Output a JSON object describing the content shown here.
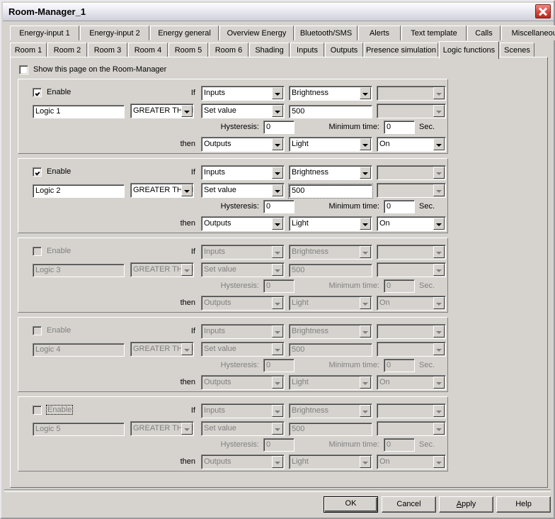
{
  "window": {
    "title": "Room-Manager_1",
    "close_label": "close-icon"
  },
  "tabs": {
    "row1": [
      {
        "label": "Energy-input 1",
        "selected": false
      },
      {
        "label": "Energy-input 2",
        "selected": false
      },
      {
        "label": "Energy general",
        "selected": false
      },
      {
        "label": "Overview Energy",
        "selected": false
      },
      {
        "label": "Bluetooth/SMS",
        "selected": false
      },
      {
        "label": "Alerts",
        "selected": false
      },
      {
        "label": "Text template",
        "selected": false
      },
      {
        "label": "Calls",
        "selected": false
      },
      {
        "label": "Miscellaneous",
        "selected": false
      }
    ],
    "row2": [
      {
        "label": "Room 1",
        "selected": false
      },
      {
        "label": "Room 2",
        "selected": false
      },
      {
        "label": "Room 3",
        "selected": false
      },
      {
        "label": "Room 4",
        "selected": false
      },
      {
        "label": "Room 5",
        "selected": false
      },
      {
        "label": "Room 6",
        "selected": false
      },
      {
        "label": "Shading",
        "selected": false
      },
      {
        "label": "Inputs",
        "selected": false
      },
      {
        "label": "Outputs",
        "selected": false
      },
      {
        "label": "Presence simulation",
        "selected": false
      },
      {
        "label": "Logic functions",
        "selected": true
      },
      {
        "label": "Scenes",
        "selected": false
      }
    ]
  },
  "show_page": {
    "label": "Show this page on the Room-Manager",
    "checked": false
  },
  "labels": {
    "enable": "Enable",
    "if": "If",
    "then": "then",
    "hysteresis": "Hysteresis:",
    "minimum_time": "Minimum time:",
    "sec": "Sec."
  },
  "logic_blocks": [
    {
      "enabled": true,
      "enable_focused": false,
      "name": "Logic 1",
      "operator": "GREATER THAN",
      "if_source": "Inputs",
      "if_channel": "Brightness",
      "if_extra": "",
      "value_mode": "Set value",
      "value": "500",
      "value_extra": "",
      "value_focused": false,
      "hysteresis": "0",
      "minimum_time": "0",
      "then_target": "Outputs",
      "then_channel": "Light",
      "then_state": "On"
    },
    {
      "enabled": true,
      "enable_focused": false,
      "name": "Logic 2",
      "operator": "GREATER THAN",
      "if_source": "Inputs",
      "if_channel": "Brightness",
      "if_extra": "",
      "value_mode": "Set value",
      "value": "500",
      "value_extra": "",
      "value_focused": true,
      "hysteresis": "0",
      "minimum_time": "0",
      "then_target": "Outputs",
      "then_channel": "Light",
      "then_state": "On"
    },
    {
      "enabled": false,
      "enable_focused": false,
      "name": "Logic 3",
      "operator": "GREATER THAN",
      "if_source": "Inputs",
      "if_channel": "Brightness",
      "if_extra": "",
      "value_mode": "Set value",
      "value": "500",
      "value_extra": "",
      "value_focused": false,
      "hysteresis": "0",
      "minimum_time": "0",
      "then_target": "Outputs",
      "then_channel": "Light",
      "then_state": "On"
    },
    {
      "enabled": false,
      "enable_focused": false,
      "name": "Logic 4",
      "operator": "GREATER THAN",
      "if_source": "Inputs",
      "if_channel": "Brightness",
      "if_extra": "",
      "value_mode": "Set value",
      "value": "500",
      "value_extra": "",
      "value_focused": false,
      "hysteresis": "0",
      "minimum_time": "0",
      "then_target": "Outputs",
      "then_channel": "Light",
      "then_state": "On"
    },
    {
      "enabled": false,
      "enable_focused": true,
      "name": "Logic 5",
      "operator": "GREATER THAN",
      "if_source": "Inputs",
      "if_channel": "Brightness",
      "if_extra": "",
      "value_mode": "Set value",
      "value": "500",
      "value_extra": "",
      "value_focused": false,
      "hysteresis": "0",
      "minimum_time": "0",
      "then_target": "Outputs",
      "then_channel": "Light",
      "then_state": "On"
    }
  ],
  "buttons": {
    "ok": "OK",
    "cancel": "Cancel",
    "apply": "Apply",
    "apply_accel": "A",
    "apply_rest": "pply",
    "help": "Help"
  },
  "colors": {
    "face": "#d6d3ce",
    "close_red": "#d8453c",
    "disabled_text": "#808080"
  }
}
